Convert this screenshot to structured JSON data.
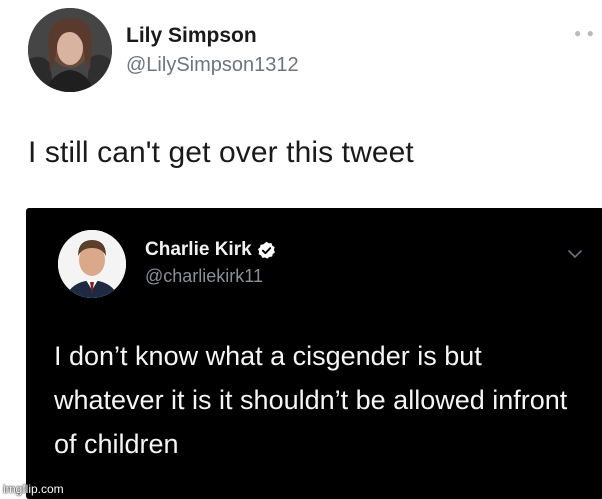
{
  "outer_tweet": {
    "author_name": "Lily Simpson",
    "author_handle": "@LilySimpson1312",
    "more_icon": "more-dots-icon",
    "text": "I still can't get over this tweet"
  },
  "embedded_tweet": {
    "author_name": "Charlie Kirk",
    "author_handle": "@charliekirk11",
    "verified_icon": "verified-badge-icon",
    "menu_icon": "chevron-down-icon",
    "text": "I don’t know what a cisgender is but whatever it is it shouldn’t be allowed infront of children",
    "background_color": "#000000",
    "verified_color": "#ffffff"
  },
  "watermark": "imgflip.com"
}
